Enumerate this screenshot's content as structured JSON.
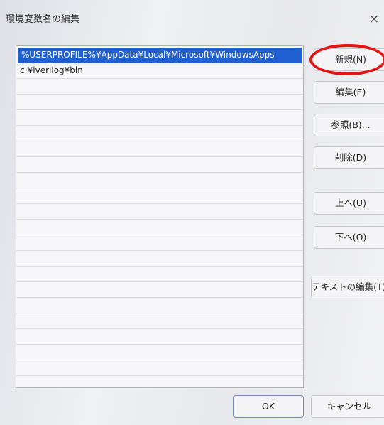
{
  "dialog": {
    "title": "環境変数名の編集",
    "close_symbol": "×"
  },
  "path_list": {
    "items": [
      "%USERPROFILE%¥AppData¥Local¥Microsoft¥WindowsApps",
      "c:¥iverilog¥bin"
    ],
    "selected_index": 0
  },
  "buttons": {
    "new": "新規(N)",
    "edit": "編集(E)",
    "browse": "参照(B)...",
    "delete": "削除(D)",
    "move_up": "上へ(U)",
    "move_down": "下へ(O)",
    "edit_text": "テキストの編集(T)...",
    "ok": "OK",
    "cancel": "キャンセル"
  },
  "annotation": {
    "highlight_color": "#e31414",
    "highlighted_button": "new"
  },
  "colors": {
    "selection": "#1f5fd1"
  }
}
